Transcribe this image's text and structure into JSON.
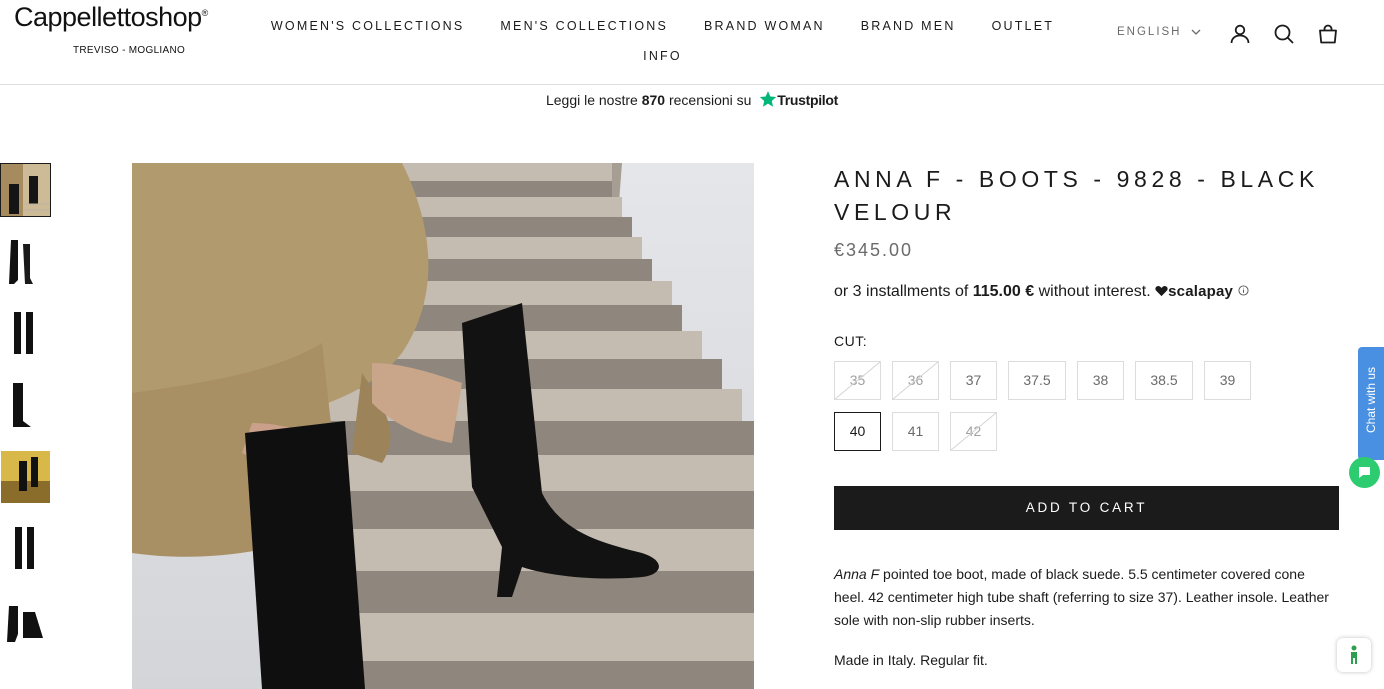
{
  "brand": {
    "name": "Cappellettoshop",
    "registered": "®",
    "tagline": "TREVISO - MOGLIANO"
  },
  "nav": {
    "items": [
      "WOMEN'S COLLECTIONS",
      "MEN'S COLLECTIONS",
      "BRAND WOMAN",
      "BRAND MEN",
      "OUTLET",
      "INFO"
    ]
  },
  "header": {
    "language": "ENGLISH",
    "icons": [
      "account-icon",
      "search-icon",
      "bag-icon"
    ]
  },
  "trust": {
    "prefix": "Leggi le nostre",
    "count": "870",
    "suffix": "recensioni su",
    "brand": "Trustpilot"
  },
  "product": {
    "title": "ANNA F - BOOTS - 9828 - BLACK VELOUR",
    "price": "€345.00",
    "installments": {
      "prefix": "or 3 installments of",
      "amount": "115.00 €",
      "suffix": "without interest.",
      "provider": "scalapay"
    },
    "cut_label": "CUT:",
    "sizes": [
      {
        "label": "35",
        "available": false,
        "selected": false
      },
      {
        "label": "36",
        "available": false,
        "selected": false
      },
      {
        "label": "37",
        "available": true,
        "selected": false
      },
      {
        "label": "37.5",
        "available": true,
        "selected": false
      },
      {
        "label": "38",
        "available": true,
        "selected": false
      },
      {
        "label": "38.5",
        "available": true,
        "selected": false
      },
      {
        "label": "39",
        "available": true,
        "selected": false
      },
      {
        "label": "40",
        "available": true,
        "selected": true
      },
      {
        "label": "41",
        "available": true,
        "selected": false
      },
      {
        "label": "42",
        "available": false,
        "selected": false
      }
    ],
    "add_to_cart": "ADD TO CART",
    "description": {
      "name": "Anna F",
      "text": " pointed toe boot, made of black suede. 5.5 centimeter covered cone heel. 42 centimeter high tube shaft (referring to size 37). Leather insole. Leather sole with non-slip rubber inserts."
    },
    "made_in": "Made in Italy. Regular fit.",
    "thumbnail_count": 7
  },
  "chat": {
    "label": "Chat with us"
  },
  "colors": {
    "text": "#1c1b1b",
    "muted": "#6b6b6b",
    "button": "#1c1b1b",
    "trustpilot_star": "#00b67a",
    "chat_tab": "#4a90e2",
    "chat_bubble": "#2ecc71"
  }
}
